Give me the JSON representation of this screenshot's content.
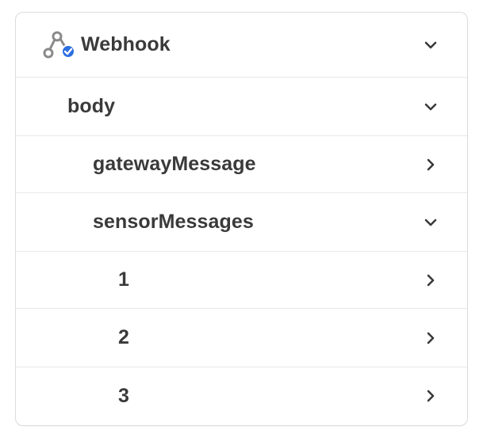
{
  "header": {
    "title": "Webhook",
    "icon": "webhook-verified-icon",
    "expanded": true
  },
  "tree": [
    {
      "label": "body",
      "level": 1,
      "expanded": true
    },
    {
      "label": "gatewayMessage",
      "level": 2,
      "expanded": false
    },
    {
      "label": "sensorMessages",
      "level": 2,
      "expanded": true
    },
    {
      "label": "1",
      "level": 3,
      "expanded": false
    },
    {
      "label": "2",
      "level": 3,
      "expanded": false
    },
    {
      "label": "3",
      "level": 3,
      "expanded": false
    }
  ],
  "colors": {
    "text": "#3a3a3a",
    "border": "#e8e8e8",
    "icon_gray": "#8a8a8a",
    "badge_blue": "#2d6fe0"
  }
}
